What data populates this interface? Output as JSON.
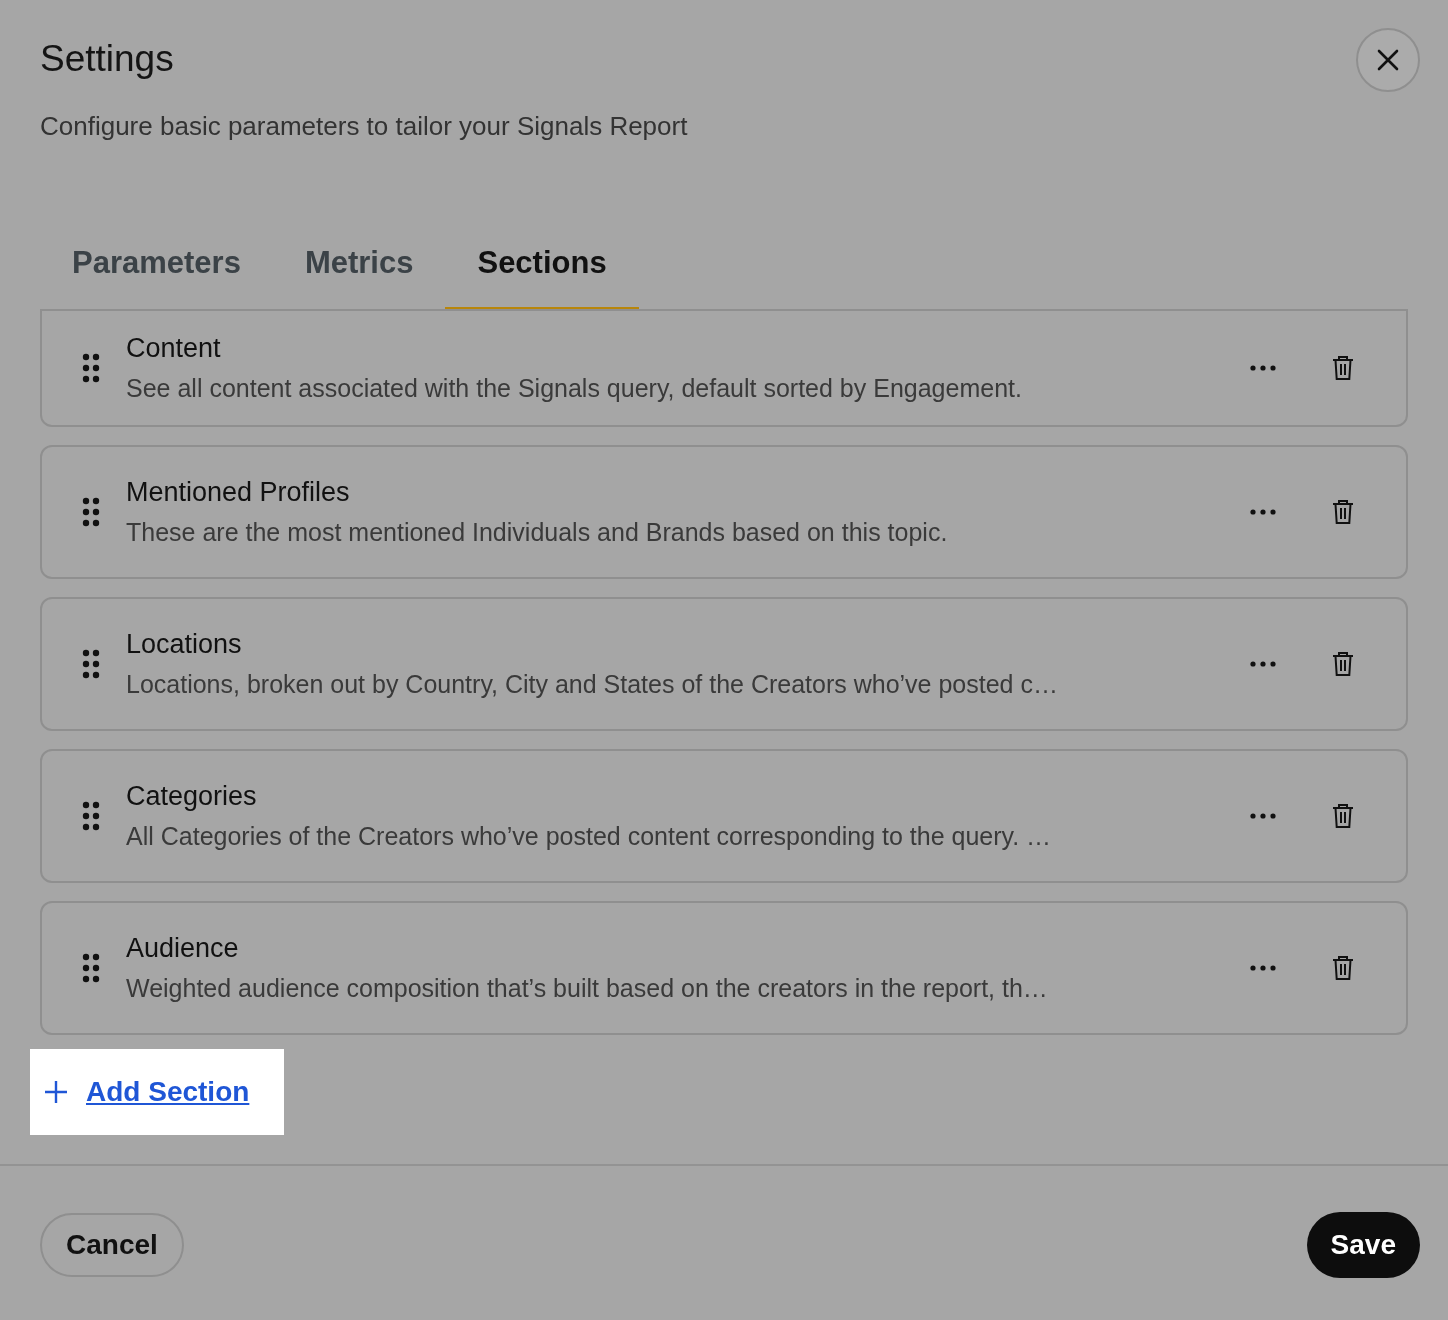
{
  "dialog": {
    "title": "Settings",
    "subtitle": "Configure basic parameters to tailor your Signals Report"
  },
  "tabs": [
    {
      "label": "Parameters",
      "selected": false
    },
    {
      "label": "Metrics",
      "selected": false
    },
    {
      "label": "Sections",
      "selected": true
    }
  ],
  "sections": [
    {
      "title": "Content",
      "description": "See all content associated with the Signals query, default sorted by Engagement."
    },
    {
      "title": "Mentioned Profiles",
      "description": "These are the most mentioned Individuals and Brands based on this topic."
    },
    {
      "title": "Locations",
      "description": "Locations, broken out by Country, City and States of the Creators who’ve posted c…"
    },
    {
      "title": "Categories",
      "description": "All Categories of the Creators who’ve posted content corresponding to the query. …"
    },
    {
      "title": "Audience",
      "description": "Weighted audience composition that’s built based on the creators in the report, th…"
    }
  ],
  "add_section": {
    "label": "Add Section"
  },
  "footer": {
    "cancel": "Cancel",
    "save": "Save"
  }
}
